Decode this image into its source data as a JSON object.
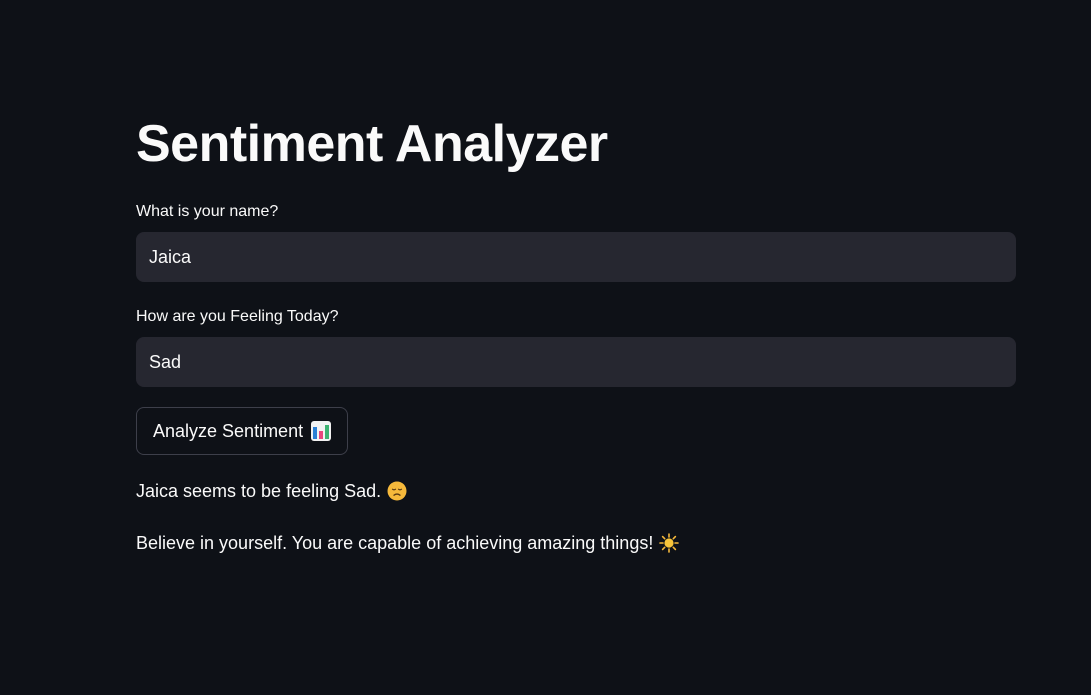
{
  "app": {
    "title": "Sentiment Analyzer"
  },
  "form": {
    "name_label": "What is your name?",
    "name_value": "Jaica",
    "feeling_label": "How are you Feeling Today?",
    "feeling_value": "Sad",
    "analyze_button_label": "Analyze Sentiment",
    "analyze_button_icon": "bar-chart-icon"
  },
  "results": {
    "sentiment_message": "Jaica seems to be feeling Sad.",
    "sentiment_icon": "sad-face-icon",
    "encouragement_message": "Believe in yourself. You are capable of achieving amazing things!",
    "encouragement_icon": "sun-icon"
  },
  "colors": {
    "background": "#0e1117",
    "input_background": "#262730",
    "text": "#fafafa",
    "button_border": "#3d3f4a"
  }
}
